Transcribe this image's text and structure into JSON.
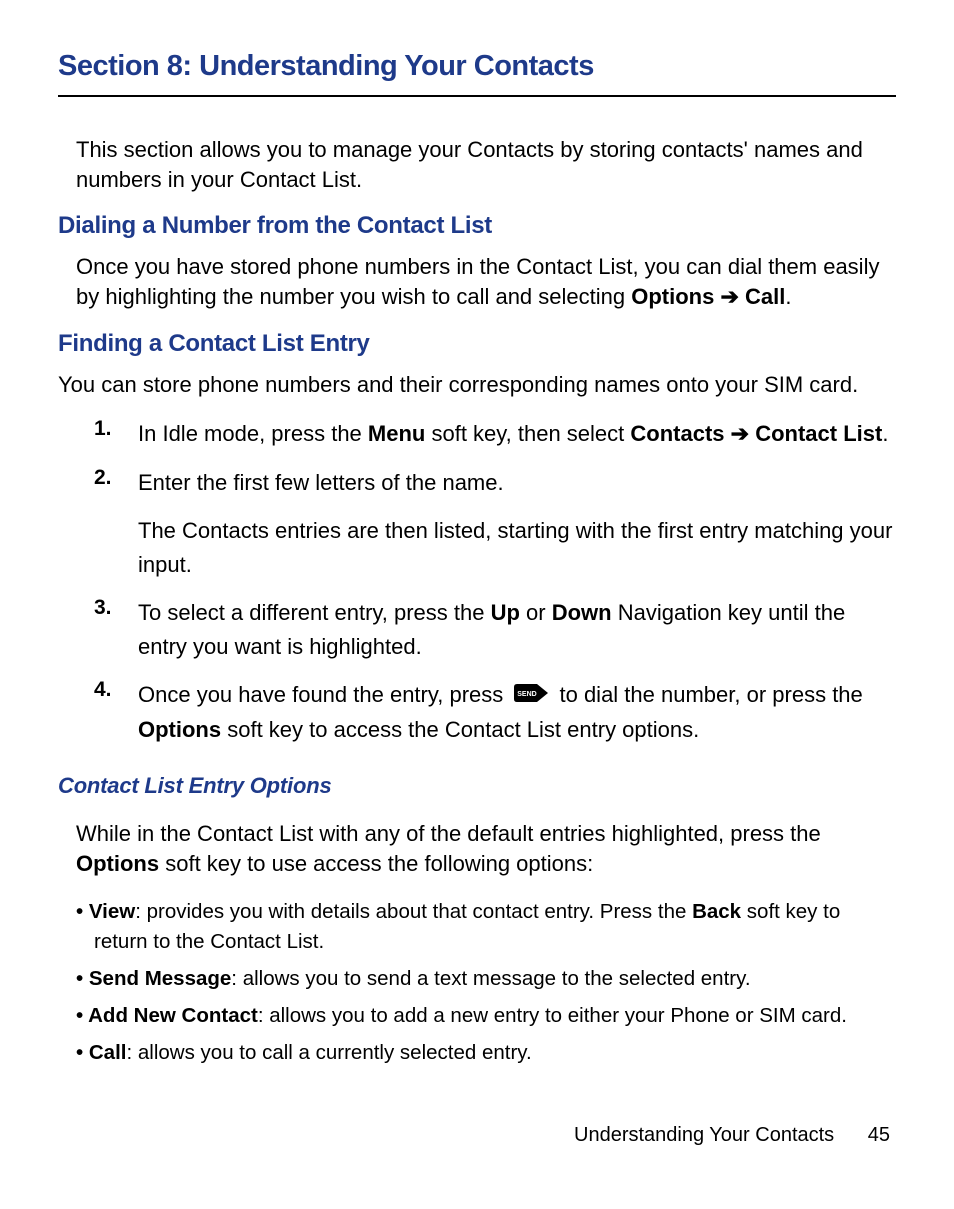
{
  "page": {
    "heading": "Section 8: Understanding Your Contacts",
    "intro": "This section allows you to manage your Contacts by storing contacts' names and numbers in your Contact List.",
    "dialing": {
      "heading": "Dialing a Number from the Contact List",
      "text_pre": "Once you have stored phone numbers in the Contact List, you can dial them easily by highlighting the number you wish to call and selecting ",
      "options_label": "Options",
      "arrow": " ➔ ",
      "call_label": "Call",
      "period": "."
    },
    "finding": {
      "heading": "Finding a Contact List Entry",
      "intro": "You can store phone numbers and their corresponding names onto your SIM card.",
      "steps": [
        {
          "num": "1.",
          "pre": "In Idle mode, press the ",
          "bold1": "Menu",
          "mid": " soft key, then select ",
          "bold2": "Contacts",
          "arrow": " ➔ ",
          "bold3": "Contact List",
          "post": "."
        },
        {
          "num": "2.",
          "text": "Enter the first few letters of the name.",
          "sub": "The Contacts entries are then listed, starting with the first entry matching your input."
        },
        {
          "num": "3.",
          "pre": "To select a different entry, press the ",
          "bold1": "Up",
          "mid1": " or ",
          "bold2": "Down",
          "post": " Navigation key until the entry you want is highlighted."
        },
        {
          "num": "4.",
          "pre": "Once you have found the entry, press ",
          "icon_label": "SEND",
          "mid": " to dial the number, or press the ",
          "bold1": "Options",
          "post": " soft key to access the Contact List entry options."
        }
      ]
    },
    "options": {
      "heading": "Contact List Entry Options",
      "intro_pre": "While in the Contact List with any of the default entries highlighted, press the ",
      "intro_bold": "Options",
      "intro_post": " soft key to use access the following options:",
      "items": [
        {
          "bold": "View",
          "text": ": provides you with details about that contact entry. Press the ",
          "bold2": "Back",
          "text2": " soft key to return to the Contact List."
        },
        {
          "bold": "Send Message",
          "text": ": allows you to send a text message to the selected entry."
        },
        {
          "bold": "Add New Contact",
          "text": ": allows you to add a new entry to either your Phone or SIM card."
        },
        {
          "bold": "Call",
          "text": ": allows you to call a currently selected entry."
        }
      ]
    },
    "footer": {
      "title": "Understanding Your Contacts",
      "page_number": "45"
    }
  }
}
